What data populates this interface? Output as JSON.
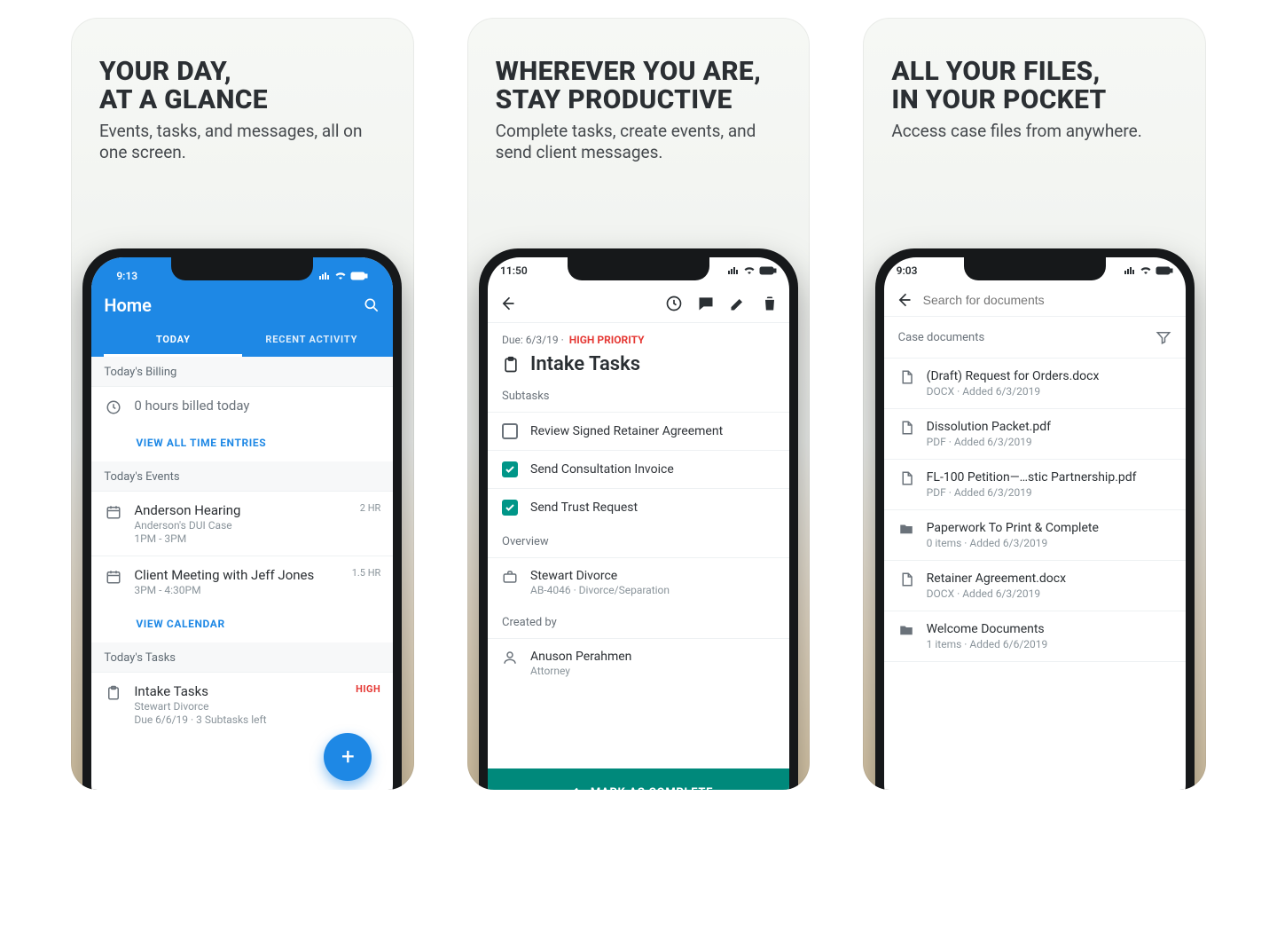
{
  "slides": [
    {
      "headline_a": "YOUR DAY,",
      "headline_b": "AT A GLANCE",
      "sub": "Events, tasks, and messages, all on one screen."
    },
    {
      "headline_a": "WHEREVER YOU ARE,",
      "headline_b": "STAY PRODUCTIVE",
      "sub": "Complete tasks, create events, and send client messages."
    },
    {
      "headline_a": "ALL YOUR FILES,",
      "headline_b": "IN YOUR POCKET",
      "sub": "Access case files from anywhere."
    }
  ],
  "phone1": {
    "time": "9:13",
    "title": "Home",
    "tab_today": "TODAY",
    "tab_recent": "RECENT ACTIVITY",
    "billing_hdr": "Today's Billing",
    "billing_line": "0 hours billed today",
    "billing_link": "VIEW ALL TIME ENTRIES",
    "events_hdr": "Today's Events",
    "event1": {
      "title": "Anderson Hearing",
      "sub": "Anderson's DUI Case",
      "time": "1PM - 3PM",
      "right": "2 HR"
    },
    "event2": {
      "title": "Client Meeting with Jeff Jones",
      "sub": "",
      "time": "3PM - 4:30PM",
      "right": "1.5 HR"
    },
    "events_link": "VIEW CALENDAR",
    "tasks_hdr": "Today's Tasks",
    "task1": {
      "title": "Intake Tasks",
      "sub": "Stewart Divorce",
      "due": "Due 6/6/19 · 3 Subtasks left",
      "pill": "HIGH"
    }
  },
  "phone2": {
    "time": "11:50",
    "due_label": "Due: 6/3/19 ·",
    "due_priority": "HIGH PRIORITY",
    "title": "Intake Tasks",
    "subtasks_hdr": "Subtasks",
    "s1": "Review Signed Retainer Agreement",
    "s2": "Send Consultation Invoice",
    "s3": "Send Trust Request",
    "overview_hdr": "Overview",
    "ov_title": "Stewart Divorce",
    "ov_sub": "AB-4046 · Divorce/Separation",
    "created_hdr": "Created by",
    "creator_name": "Anuson Perahmen",
    "creator_role": "Attorney",
    "mark": "MARK AS COMPLETE"
  },
  "phone3": {
    "time": "9:03",
    "search_ph": "Search for documents",
    "list_hdr": "Case documents",
    "docs": [
      {
        "t": "(Draft) Request for Orders.docx",
        "m": "DOCX · Added 6/3/2019",
        "k": "file"
      },
      {
        "t": "Dissolution Packet.pdf",
        "m": "PDF · Added 6/3/2019",
        "k": "file"
      },
      {
        "t": "FL-100 Petition—…stic Partnership.pdf",
        "m": "PDF · Added 6/3/2019",
        "k": "file"
      },
      {
        "t": "Paperwork To Print & Complete",
        "m": "0 items · Added 6/3/2019",
        "k": "folder"
      },
      {
        "t": "Retainer Agreement.docx",
        "m": "DOCX · Added 6/3/2019",
        "k": "file"
      },
      {
        "t": "Welcome Documents",
        "m": "1 items · Added 6/6/2019",
        "k": "folder"
      }
    ]
  }
}
